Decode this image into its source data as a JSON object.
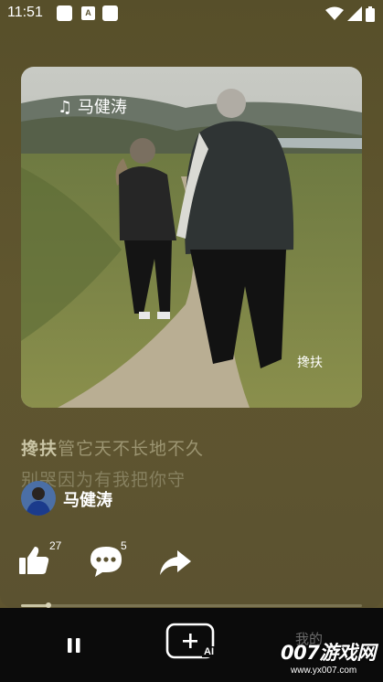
{
  "status_bar": {
    "time": "11:51",
    "a_label": "A"
  },
  "cover": {
    "title_text": "♫ 马健涛",
    "corner_text": "搀扶"
  },
  "lyrics": {
    "line1_highlight": "搀扶",
    "line1_rest": "管它天不长地不久",
    "line2": "别哭因为有我把你守"
  },
  "artist": {
    "name": "马健涛"
  },
  "actions": {
    "like_count": "27",
    "comment_count": "5"
  },
  "player": {
    "progress": 0.08
  },
  "nav": {
    "ai_label": "AI",
    "me_label": "我的"
  },
  "watermark": {
    "brand": "007游戏网",
    "url": "www.yx007.com"
  },
  "colors": {
    "background": "#5f5530",
    "navbar": "#0b0b0b",
    "lyric_highlight": "#c9c4a4"
  }
}
